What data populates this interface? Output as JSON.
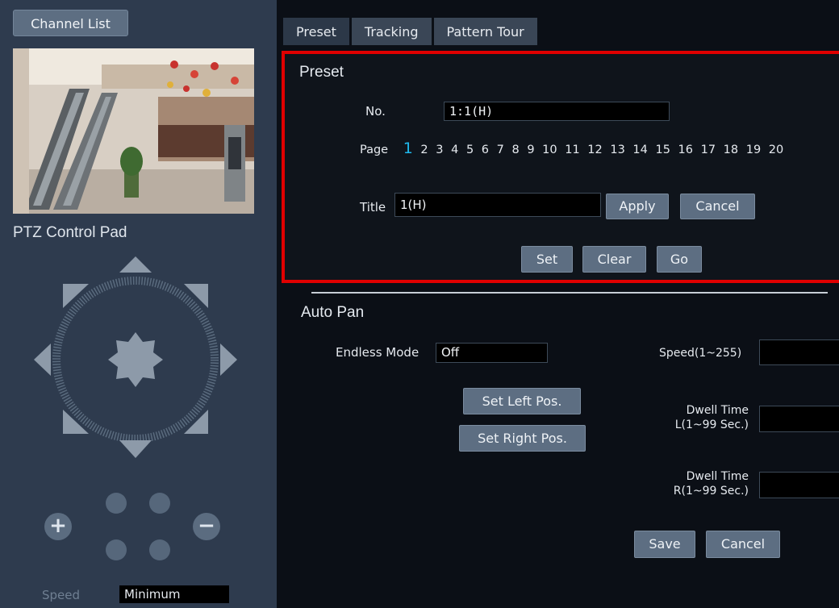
{
  "left": {
    "channel_list": "Channel List",
    "ptz_title": "PTZ Control Pad",
    "speed_label": "Speed",
    "speed_value": "Minimum"
  },
  "tabs": [
    "Preset",
    "Tracking",
    "Pattern Tour"
  ],
  "preset": {
    "title": "Preset",
    "no_label": "No.",
    "no_value": "1:1(H)",
    "page_label": "Page",
    "pages": [
      "1",
      "2",
      "3",
      "4",
      "5",
      "6",
      "7",
      "8",
      "9",
      "10",
      "11",
      "12",
      "13",
      "14",
      "15",
      "16",
      "17",
      "18",
      "19",
      "20"
    ],
    "current_page": "1",
    "title_label": "Title",
    "title_value": "1(H)",
    "apply": "Apply",
    "cancel": "Cancel",
    "set": "Set",
    "clear": "Clear",
    "go": "Go"
  },
  "autopan": {
    "title": "Auto Pan",
    "endless_label": "Endless Mode",
    "endless_value": "Off",
    "set_left": "Set Left Pos.",
    "set_right": "Set Right Pos.",
    "speed_label": "Speed(1~255)",
    "dwell_l_line1": "Dwell Time",
    "dwell_l_line2": "L(1~99 Sec.)",
    "dwell_r_line1": "Dwell Time",
    "dwell_r_line2": "R(1~99 Sec.)",
    "save": "Save",
    "cancel": "Cancel"
  },
  "colors": {
    "highlight_border": "#e00000",
    "current_page": "#1fb8ec",
    "button": "#5d6e82"
  }
}
